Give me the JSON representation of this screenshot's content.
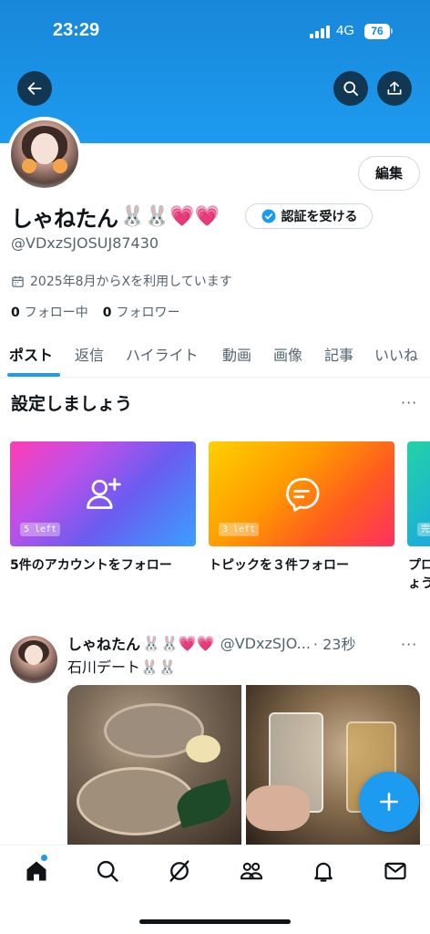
{
  "status_bar": {
    "time": "23:29",
    "network": "4G",
    "battery": "76"
  },
  "colors": {
    "accent": "#1d9bf0",
    "banner": "#1887d9",
    "text": "#0f1419",
    "muted": "#536471"
  },
  "header": {
    "back_icon": "arrow-left-icon",
    "search_icon": "search-icon",
    "share_icon": "share-icon"
  },
  "profile": {
    "edit_label": "編集",
    "name": "しゃねたん",
    "name_emoji": "🐰🐰💗💗",
    "verify_label": "認証を受ける",
    "handle": "@VDxzSJOSUJ87430",
    "joined": "2025年8月からXを利用しています",
    "following_count": "0",
    "following_label": "フォロー中",
    "followers_count": "0",
    "followers_label": "フォロワー"
  },
  "tabs": [
    {
      "label": "ポスト",
      "active": true
    },
    {
      "label": "返信"
    },
    {
      "label": "ハイライト"
    },
    {
      "label": "動画"
    },
    {
      "label": "画像"
    },
    {
      "label": "記事"
    },
    {
      "label": "いいね"
    }
  ],
  "setup": {
    "title": "設定しましょう",
    "more": "···",
    "cards": [
      {
        "badge": "5 left",
        "label": "5件のアカウントをフォロー",
        "icon": "add-user-icon"
      },
      {
        "badge": "3 left",
        "label": "トピックを３件フォロー",
        "icon": "topic-bubble-icon"
      },
      {
        "badge": "完",
        "label": "プロ",
        "label2": "ょう"
      }
    ]
  },
  "post": {
    "name": "しゃねたん",
    "name_emoji": "🐰🐰💗💗",
    "handle": "@VDxzSJO...",
    "time": "· 23秒",
    "more": "···",
    "text": "石川デート🐰🐰"
  },
  "bottom_nav": {
    "items": [
      "home-icon",
      "search-icon",
      "grok-icon",
      "communities-icon",
      "notifications-icon",
      "messages-icon"
    ]
  }
}
